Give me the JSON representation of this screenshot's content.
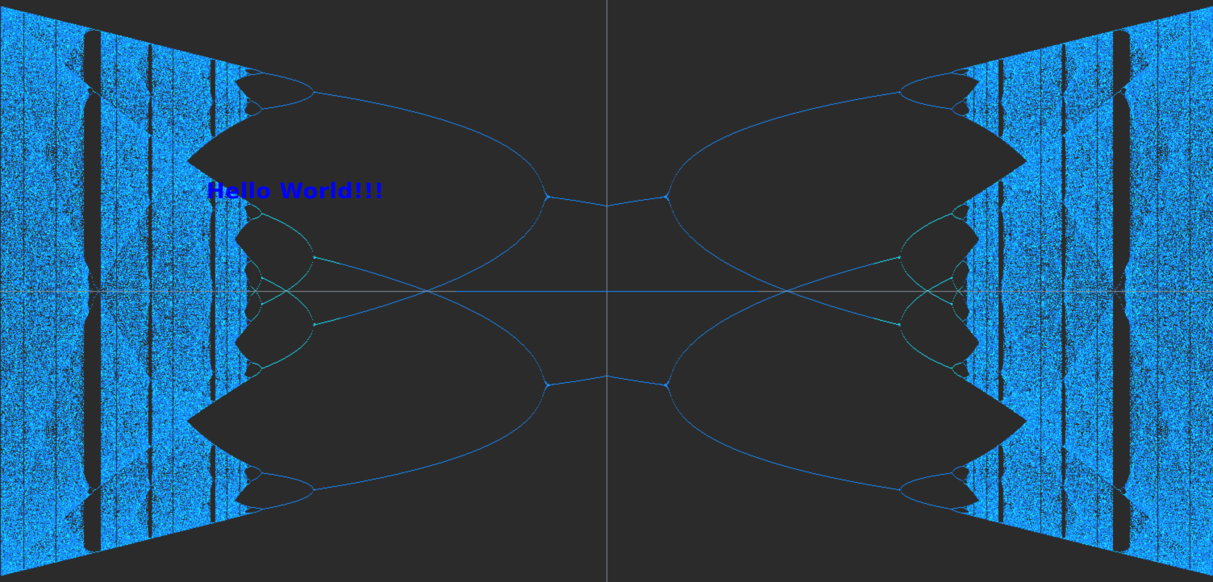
{
  "overlay": {
    "text": "Hello  World!!!",
    "color": "#0000ff"
  },
  "colors": {
    "background": "#2b2b2b",
    "axis": "#7f8b94",
    "orbit_blue": "#1a8cff",
    "orbit_cyan": "#19e6ff",
    "orbit_dark": "#0b5f9e"
  }
}
